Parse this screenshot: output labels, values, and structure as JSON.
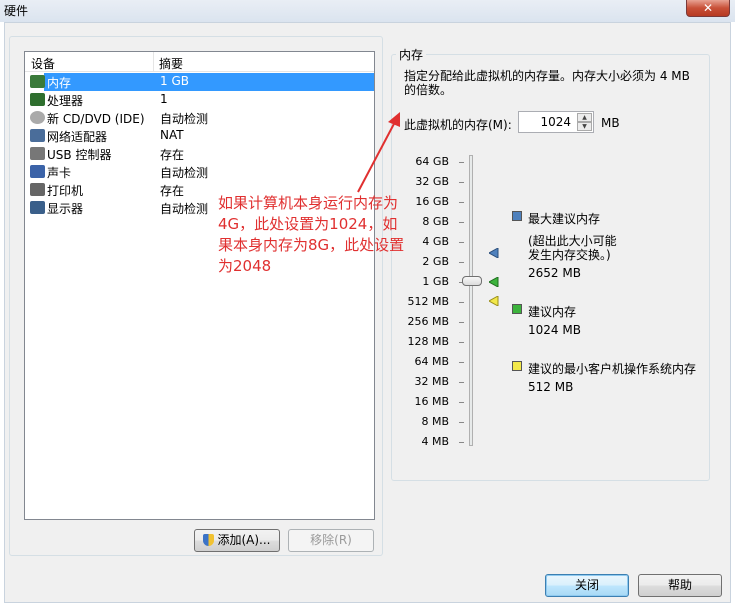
{
  "window": {
    "title": "硬件",
    "close_glyph": "✕"
  },
  "device_list": {
    "col_device": "设备",
    "col_summary": "摘要",
    "rows": [
      {
        "name": "内存",
        "summary": "1 GB",
        "icon": "memory-icon"
      },
      {
        "name": "处理器",
        "summary": "1",
        "icon": "processor-icon"
      },
      {
        "name": "新 CD/DVD (IDE)",
        "summary": "自动检测",
        "icon": "cd-dvd-icon"
      },
      {
        "name": "网络适配器",
        "summary": "NAT",
        "icon": "network-adapter-icon"
      },
      {
        "name": "USB 控制器",
        "summary": "存在",
        "icon": "usb-icon"
      },
      {
        "name": "声卡",
        "summary": "自动检测",
        "icon": "sound-card-icon"
      },
      {
        "name": "打印机",
        "summary": "存在",
        "icon": "printer-icon"
      },
      {
        "name": "显示器",
        "summary": "自动检测",
        "icon": "display-icon"
      }
    ],
    "selected": "内存"
  },
  "buttons": {
    "add": "添加(A)...",
    "remove": "移除(R)",
    "close": "关闭",
    "help": "帮助"
  },
  "memory": {
    "group_title": "内存",
    "desc_line1": "指定分配给此虚拟机的内存量。内存大小必须为 4 MB",
    "desc_line2": "的倍数。",
    "field_label": "此虚拟机的内存(M):",
    "value": "1024",
    "unit": "MB",
    "scale": [
      "64 GB",
      "32 GB",
      "16 GB",
      "8 GB",
      "4 GB",
      "2 GB",
      "1 GB",
      "512 MB",
      "256 MB",
      "128 MB",
      "64 MB",
      "32 MB",
      "16 MB",
      "8 MB",
      "4 MB"
    ],
    "max_recommended_title": "最大建议内存",
    "max_recommended_note1": "(超出此大小可能",
    "max_recommended_note2": "发生内存交换。)",
    "max_recommended_value": "2652 MB",
    "recommended_title": "建议内存",
    "recommended_value": "1024 MB",
    "min_guest_title": "建议的最小客户机操作系统内存",
    "min_guest_value": "512 MB",
    "colors": {
      "max": "#4f81bd",
      "recommended": "#3cb33c",
      "min": "#f2e84a"
    }
  },
  "annotation": {
    "text": "如果计算机本身运行内存为4G，此处设置为1024，如果本身内存为8G，此处设置为2048",
    "color": "#e03030"
  }
}
